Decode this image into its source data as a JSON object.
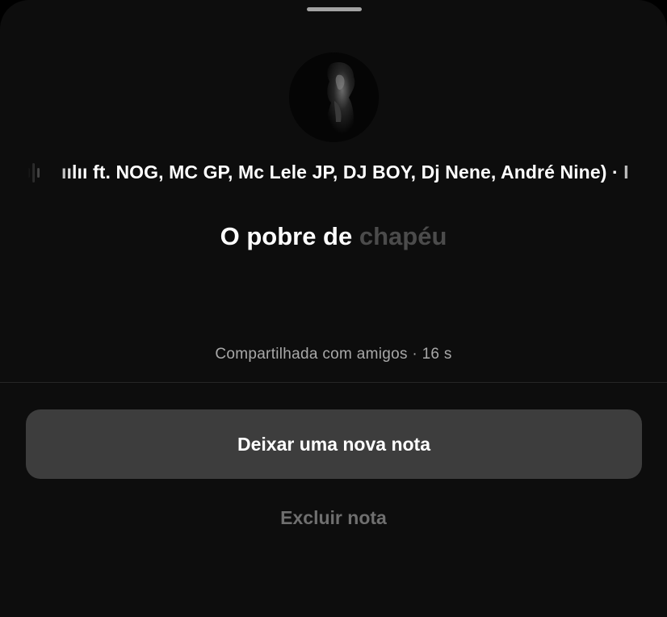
{
  "note": {
    "music_ticker": "ıılıı ft. NOG, MC GP, Mc Lele JP, DJ BOY, Dj Nene, André Nine) · I",
    "text_shown": "O pobre de ",
    "text_fading": "chapéu",
    "shared_meta": "Compartilhada com amigos · 16 s"
  },
  "actions": {
    "new_note_label": "Deixar uma nova nota",
    "delete_note_label": "Excluir nota"
  },
  "icons": {
    "music": "audio-wave-icon",
    "avatar": "profile-photo"
  },
  "colors": {
    "sheet_bg": "#0d0d0d",
    "primary_button_bg": "#3d3d3d",
    "muted_text": "#a8a8a8",
    "faded_text": "#4b4b4b",
    "disabled_text": "#6f6f6f"
  }
}
